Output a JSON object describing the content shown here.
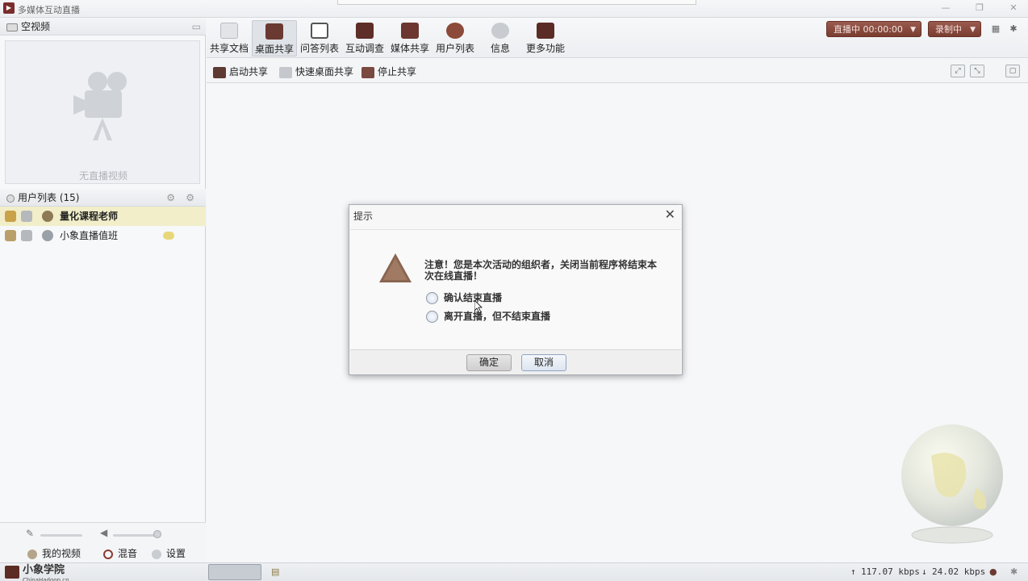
{
  "app": {
    "title": "多媒体互动直播"
  },
  "left": {
    "video_header": "空视频",
    "no_video_text": "无直播视频",
    "user_list_header": "用户列表 (15)",
    "users": [
      {
        "name": "量化课程老师"
      },
      {
        "name": "小象直播值班"
      }
    ],
    "my_video": "我的视频",
    "mix": "混音",
    "settings": "设置"
  },
  "toolbar": {
    "items": [
      {
        "label": "共享文档"
      },
      {
        "label": "桌面共享"
      },
      {
        "label": "问答列表"
      },
      {
        "label": "互动调查"
      },
      {
        "label": "媒体共享"
      },
      {
        "label": "用户列表"
      },
      {
        "label": "信息"
      },
      {
        "label": "更多功能"
      }
    ],
    "live_status": "直播中 00:00:00",
    "record_status": "录制中"
  },
  "subtoolbar": {
    "start_share": "启动共享",
    "quick_share": "快速桌面共享",
    "stop_share": "停止共享"
  },
  "dialog": {
    "title": "提示",
    "message": "注意！您是本次活动的组织者，关闭当前程序将结束本次在线直播！",
    "option1": "确认结束直播",
    "option2": "离开直播，但不结束直播",
    "ok": "确定",
    "cancel": "取消"
  },
  "status": {
    "brand_name": "小象学院",
    "brand_url": "ChinaHadoop.cn",
    "upload_rate": "117.07 kbps",
    "download_rate": "24.02 kbps"
  },
  "colors": {
    "accent_pill": "#7a3d31",
    "active_row": "#f1eec9"
  }
}
